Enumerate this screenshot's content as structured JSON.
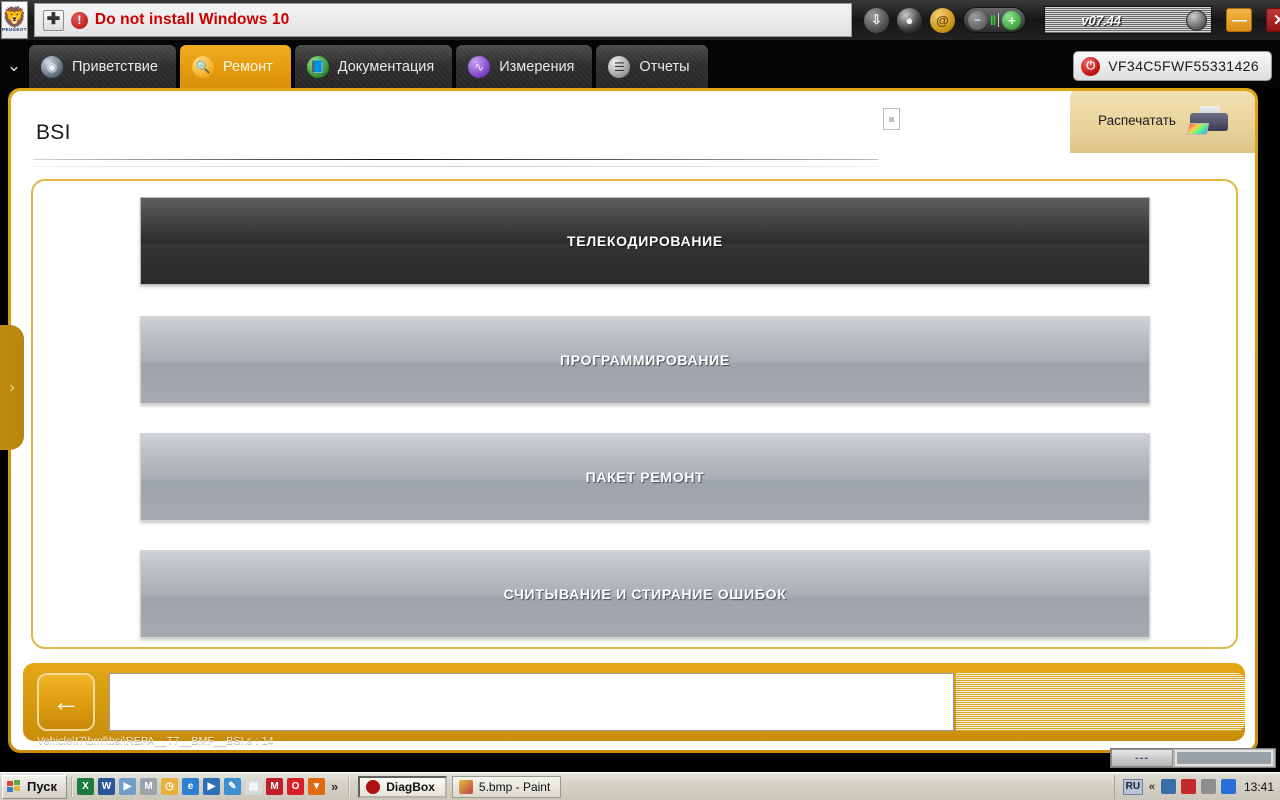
{
  "titlebar": {
    "logo_word": "PEUGEOT",
    "plus_label": "✚",
    "warn_label": "!",
    "notice": "Do not install Windows 10",
    "version": "v07.44",
    "icons": [
      "download-icon",
      "person-icon",
      "at-icon"
    ],
    "transport": {
      "minus": "−",
      "pause": "‖",
      "plus": "+"
    },
    "minimize_label": "—",
    "close_label": "✕"
  },
  "tabs": {
    "chevron": "⌄",
    "items": [
      {
        "label": "Приветствие",
        "icon": "compass-icon",
        "active": false
      },
      {
        "label": "Ремонт",
        "icon": "magnifier-icon",
        "active": true
      },
      {
        "label": "Документация",
        "icon": "book-icon",
        "active": false
      },
      {
        "label": "Измерения",
        "icon": "waveform-icon",
        "active": false
      },
      {
        "label": "Отчеты",
        "icon": "report-icon",
        "active": false
      }
    ],
    "vin": "VF34C5FWF55331426"
  },
  "page": {
    "title": "BSI",
    "print_label": "Распечатать",
    "flyout_chevron": "›",
    "options": [
      {
        "label": "ТЕЛЕКОДИРОВАНИЕ",
        "state": "selected"
      },
      {
        "label": "ПРОГРАММИРОВАНИЕ",
        "state": "normal"
      },
      {
        "label": "ПАКЕТ РЕМОНТ",
        "state": "normal"
      },
      {
        "label": "СЧИТЫВАНИЕ И СТИРАНИЕ ОШИБОК",
        "state": "normal"
      }
    ],
    "back_arrow": "←",
    "input_value": "",
    "status_path": "Vehicle\\t7\\bmf\\bsi\\REPA__T7__BMF__BSI.s : 14"
  },
  "mini_widget": {
    "label": "---"
  },
  "taskbar": {
    "start_label": "Пуск",
    "quick_launch": [
      {
        "name": "excel-icon",
        "glyph": "X",
        "color": "#1d7a3f"
      },
      {
        "name": "word-icon",
        "glyph": "W",
        "color": "#2a5699"
      },
      {
        "name": "media-icon",
        "glyph": "▶",
        "color": "#6f9fc8"
      },
      {
        "name": "shield-icon",
        "glyph": "M",
        "color": "#9aa4ad"
      },
      {
        "name": "clock-icon",
        "glyph": "◷",
        "color": "#e8b13a"
      },
      {
        "name": "ie-icon",
        "glyph": "e",
        "color": "#2f7fd0"
      },
      {
        "name": "player-icon",
        "glyph": "▶",
        "color": "#2f6fb8"
      },
      {
        "name": "editor-icon",
        "glyph": "✎",
        "color": "#3d8fd0"
      },
      {
        "name": "save-icon",
        "glyph": "▤",
        "color": "#d8d8d8"
      },
      {
        "name": "mplayer-icon",
        "glyph": "M",
        "color": "#c01f2a"
      },
      {
        "name": "opera-icon",
        "glyph": "O",
        "color": "#d8202a"
      },
      {
        "name": "download-icon",
        "glyph": "▼",
        "color": "#e06a10"
      }
    ],
    "more_label": "»",
    "items": [
      {
        "label": "DiagBox",
        "icon": "diagbox-icon",
        "active": true
      },
      {
        "label": "5.bmp - Paint",
        "icon": "paint-icon",
        "active": false
      }
    ],
    "tray": {
      "lang": "RU",
      "chevron": "«",
      "icons": [
        {
          "name": "network-icon",
          "color": "#3a6ea8"
        },
        {
          "name": "antivirus-icon",
          "color": "#c42a2a"
        },
        {
          "name": "volume-icon",
          "color": "#8e8e8e"
        },
        {
          "name": "battery-icon",
          "color": "#2a6fd8"
        }
      ],
      "clock": "13:41"
    }
  }
}
